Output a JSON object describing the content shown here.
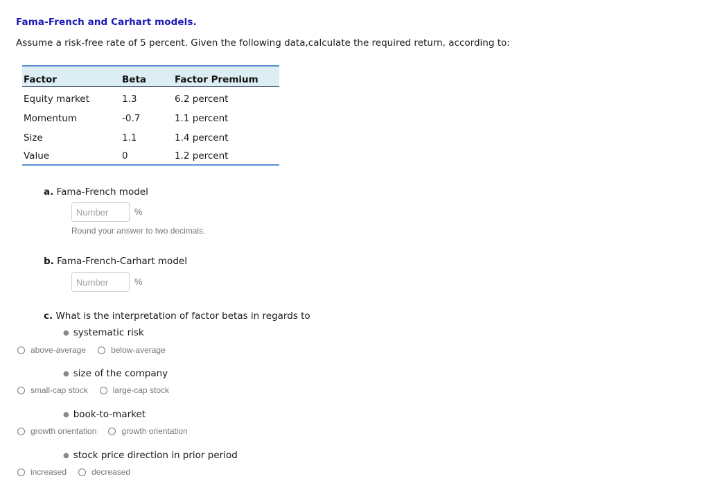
{
  "title": "Fama-French and Carhart models.",
  "intro": "Assume a risk-free rate of 5 percent. Given the following data,calculate the required return, according to:",
  "table": {
    "headers": [
      "Factor",
      "Beta",
      "Factor Premium"
    ],
    "rows": [
      {
        "factor": "Equity market",
        "beta": "1.3",
        "premium": "6.2 percent"
      },
      {
        "factor": "Momentum",
        "beta": "-0.7",
        "premium": "1.1 percent"
      },
      {
        "factor": "Size",
        "beta": "1.1",
        "premium": "1.4 percent"
      },
      {
        "factor": "Value",
        "beta": "0",
        "premium": "1.2 percent"
      }
    ]
  },
  "part_a": {
    "letter": "a.",
    "label": "Fama-French model",
    "input_value": "",
    "placeholder": "Number",
    "unit": "%",
    "hint": "Round your answer to two decimals."
  },
  "part_b": {
    "letter": "b.",
    "label": "Fama-French-Carhart model",
    "input_value": "",
    "placeholder": "Number",
    "unit": "%"
  },
  "part_c": {
    "letter": "c.",
    "question": "What is the interpretation of factor betas in regards to",
    "items": [
      {
        "bullet": "systematic risk",
        "options": [
          "above-average",
          "below-average"
        ]
      },
      {
        "bullet": "size of the company",
        "options": [
          "small-cap stock",
          "large-cap stock"
        ]
      },
      {
        "bullet": "book-to-market",
        "options": [
          "growth orientation",
          "growth orientation"
        ]
      },
      {
        "bullet": "stock price direction in prior period",
        "options": [
          "increased",
          "decreased"
        ]
      }
    ]
  },
  "colors": {
    "title": "#1a1ab8",
    "table_header_bg": "#dcedf3",
    "table_rule": "#5a8fcf"
  }
}
